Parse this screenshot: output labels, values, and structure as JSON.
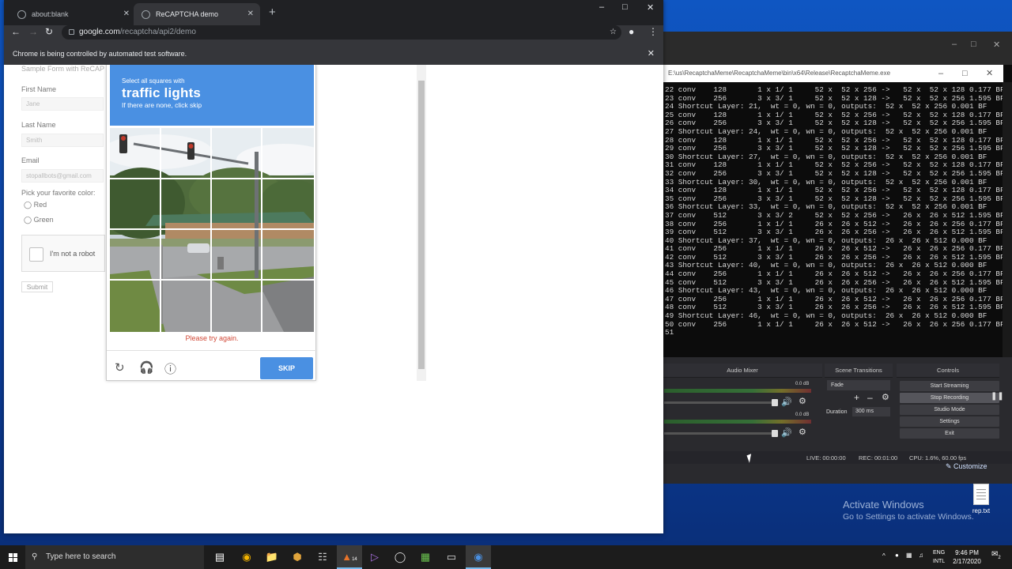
{
  "browser": {
    "tabs": [
      {
        "label": "about:blank",
        "active": false
      },
      {
        "label": "ReCAPTCHA demo",
        "active": true
      }
    ],
    "new_tab_icon": "plus-icon",
    "url_host": "google.com",
    "url_path": "/recaptcha/api2/demo",
    "infobar_text": "Chrome is being controlled by automated test software."
  },
  "form": {
    "title": "Sample Form with ReCAP",
    "first_name_label": "First Name",
    "first_name_value": "Jane",
    "last_name_label": "Last Name",
    "last_name_value": "Smith",
    "email_label": "Email",
    "email_value": "stopallbots@gmail.com",
    "color_label": "Pick your favorite color:",
    "color_options": [
      "Red",
      "Green"
    ],
    "checkbox_label": "I'm not a robot",
    "submit_label": "Submit"
  },
  "challenge": {
    "instruction_small": "Select all squares with",
    "target": "traffic lights",
    "hint": "If there are none, click skip",
    "error": "Please try again.",
    "button": "SKIP",
    "grid_size": 4
  },
  "console": {
    "title": "E:\\us\\RecaptchaMeme\\RecaptchaMeme\\bin\\x64\\Release\\RecaptchaMeme.exe",
    "lines": [
      "22 conv    128       1 x 1/ 1     52 x  52 x 256 ->   52 x  52 x 128 0.177 BF",
      "23 conv    256       3 x 3/ 1     52 x  52 x 128 ->   52 x  52 x 256 1.595 BF",
      "24 Shortcut Layer: 21,  wt = 0, wn = 0, outputs:  52 x  52 x 256 0.001 BF",
      "25 conv    128       1 x 1/ 1     52 x  52 x 256 ->   52 x  52 x 128 0.177 BF",
      "26 conv    256       3 x 3/ 1     52 x  52 x 128 ->   52 x  52 x 256 1.595 BF",
      "27 Shortcut Layer: 24,  wt = 0, wn = 0, outputs:  52 x  52 x 256 0.001 BF",
      "28 conv    128       1 x 1/ 1     52 x  52 x 256 ->   52 x  52 x 128 0.177 BF",
      "29 conv    256       3 x 3/ 1     52 x  52 x 128 ->   52 x  52 x 256 1.595 BF",
      "30 Shortcut Layer: 27,  wt = 0, wn = 0, outputs:  52 x  52 x 256 0.001 BF",
      "31 conv    128       1 x 1/ 1     52 x  52 x 256 ->   52 x  52 x 128 0.177 BF",
      "32 conv    256       3 x 3/ 1     52 x  52 x 128 ->   52 x  52 x 256 1.595 BF",
      "33 Shortcut Layer: 30,  wt = 0, wn = 0, outputs:  52 x  52 x 256 0.001 BF",
      "34 conv    128       1 x 1/ 1     52 x  52 x 256 ->   52 x  52 x 128 0.177 BF",
      "35 conv    256       3 x 3/ 1     52 x  52 x 128 ->   52 x  52 x 256 1.595 BF",
      "36 Shortcut Layer: 33,  wt = 0, wn = 0, outputs:  52 x  52 x 256 0.001 BF",
      "37 conv    512       3 x 3/ 2     52 x  52 x 256 ->   26 x  26 x 512 1.595 BF",
      "38 conv    256       1 x 1/ 1     26 x  26 x 512 ->   26 x  26 x 256 0.177 BF",
      "39 conv    512       3 x 3/ 1     26 x  26 x 256 ->   26 x  26 x 512 1.595 BF",
      "40 Shortcut Layer: 37,  wt = 0, wn = 0, outputs:  26 x  26 x 512 0.000 BF",
      "41 conv    256       1 x 1/ 1     26 x  26 x 512 ->   26 x  26 x 256 0.177 BF",
      "42 conv    512       3 x 3/ 1     26 x  26 x 256 ->   26 x  26 x 512 1.595 BF",
      "43 Shortcut Layer: 40,  wt = 0, wn = 0, outputs:  26 x  26 x 512 0.000 BF",
      "44 conv    256       1 x 1/ 1     26 x  26 x 512 ->   26 x  26 x 256 0.177 BF",
      "45 conv    512       3 x 3/ 1     26 x  26 x 256 ->   26 x  26 x 512 1.595 BF",
      "46 Shortcut Layer: 43,  wt = 0, wn = 0, outputs:  26 x  26 x 512 0.000 BF",
      "47 conv    256       1 x 1/ 1     26 x  26 x 512 ->   26 x  26 x 256 0.177 BF",
      "48 conv    512       3 x 3/ 1     26 x  26 x 256 ->   26 x  26 x 512 1.595 BF",
      "49 Shortcut Layer: 46,  wt = 0, wn = 0, outputs:  26 x  26 x 512 0.000 BF",
      "50 conv    256       1 x 1/ 1     26 x  26 x 512 ->   26 x  26 x 256 0.177 BF",
      "51"
    ]
  },
  "obs": {
    "audio_mixer_label": "Audio Mixer",
    "meter_db_1": "0.0 dB",
    "meter_db_2": "0.0 dB",
    "scene_transitions_label": "Scene Transitions",
    "transition_value": "Fade",
    "duration_label": "Duration",
    "duration_value": "300 ms",
    "controls_label": "Controls",
    "buttons": [
      "Start Streaming",
      "Stop Recording",
      "Studio Mode",
      "Settings",
      "Exit"
    ],
    "status_live": "LIVE: 00:00:00",
    "status_rec": "REC: 00:01:00",
    "status_cpu": "CPU: 1.6%, 60.00 fps"
  },
  "desktop": {
    "customize_label": "Customize",
    "file_label": "rep.txt",
    "activate_title": "Activate Windows",
    "activate_sub": "Go to Settings to activate Windows."
  },
  "taskbar": {
    "search_placeholder": "Type here to search",
    "lang_1": "ENG",
    "lang_2": "INTL",
    "time": "9:46 PM",
    "date": "2/17/2020",
    "notification_count": "2",
    "badge_count": "14"
  },
  "colors": {
    "accent": "#4a90e2",
    "error": "#d14836",
    "chrome_dark": "#35363a",
    "taskbar": "#1c1c1c"
  }
}
